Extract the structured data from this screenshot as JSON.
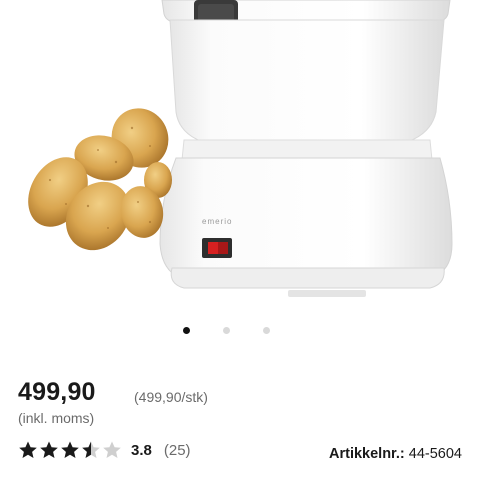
{
  "product": {
    "brand_mark": "emerio",
    "image_alt": "Potato peeler with potatoes"
  },
  "carousel": {
    "total": 3,
    "active_index": 0
  },
  "pricing": {
    "price": "499,90",
    "unit_price": "(499,90/stk)",
    "vat_note": "(inkl. moms)"
  },
  "rating": {
    "score": 3.8,
    "score_label": "3.8",
    "count_label": "(25)",
    "max_stars": 5
  },
  "article": {
    "label": "Artikkelnr.:",
    "number": "44-5604"
  },
  "colors": {
    "text": "#1a1a1a",
    "muted": "#6b6b6b",
    "star": "#1a1a1a",
    "star_empty": "#cfcfcf",
    "switch": "#d62020"
  }
}
